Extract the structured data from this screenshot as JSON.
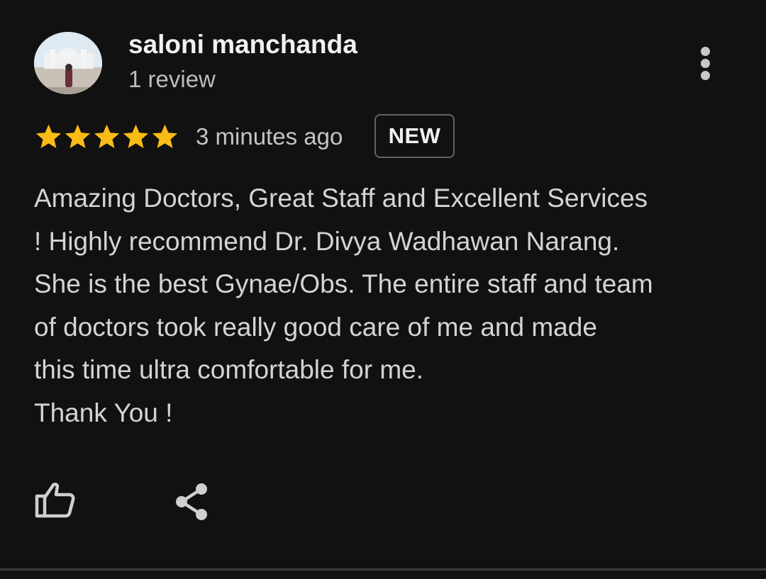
{
  "review": {
    "reviewer_name": "saloni manchanda",
    "review_count": "1 review",
    "rating": 5,
    "max_rating": 5,
    "timestamp": "3 minutes ago",
    "badge": "NEW",
    "text_lines": [
      "Amazing Doctors, Great Staff and Excellent Services",
      "! Highly recommend Dr. Divya Wadhawan Narang.",
      "She is the best Gynae/Obs. The entire staff and team",
      "of doctors took really good care of me and made",
      "this time ultra comfortable for me.",
      "Thank You !"
    ]
  },
  "icons": {
    "star": "star-icon",
    "more": "more-vert-icon",
    "like": "thumb-up-icon",
    "share": "share-icon"
  },
  "colors": {
    "background": "#111111",
    "star": "#f9bc16",
    "badge_border": "#5f6368",
    "text": "#d4d4d4",
    "secondary_text": "#bdbdbd"
  }
}
